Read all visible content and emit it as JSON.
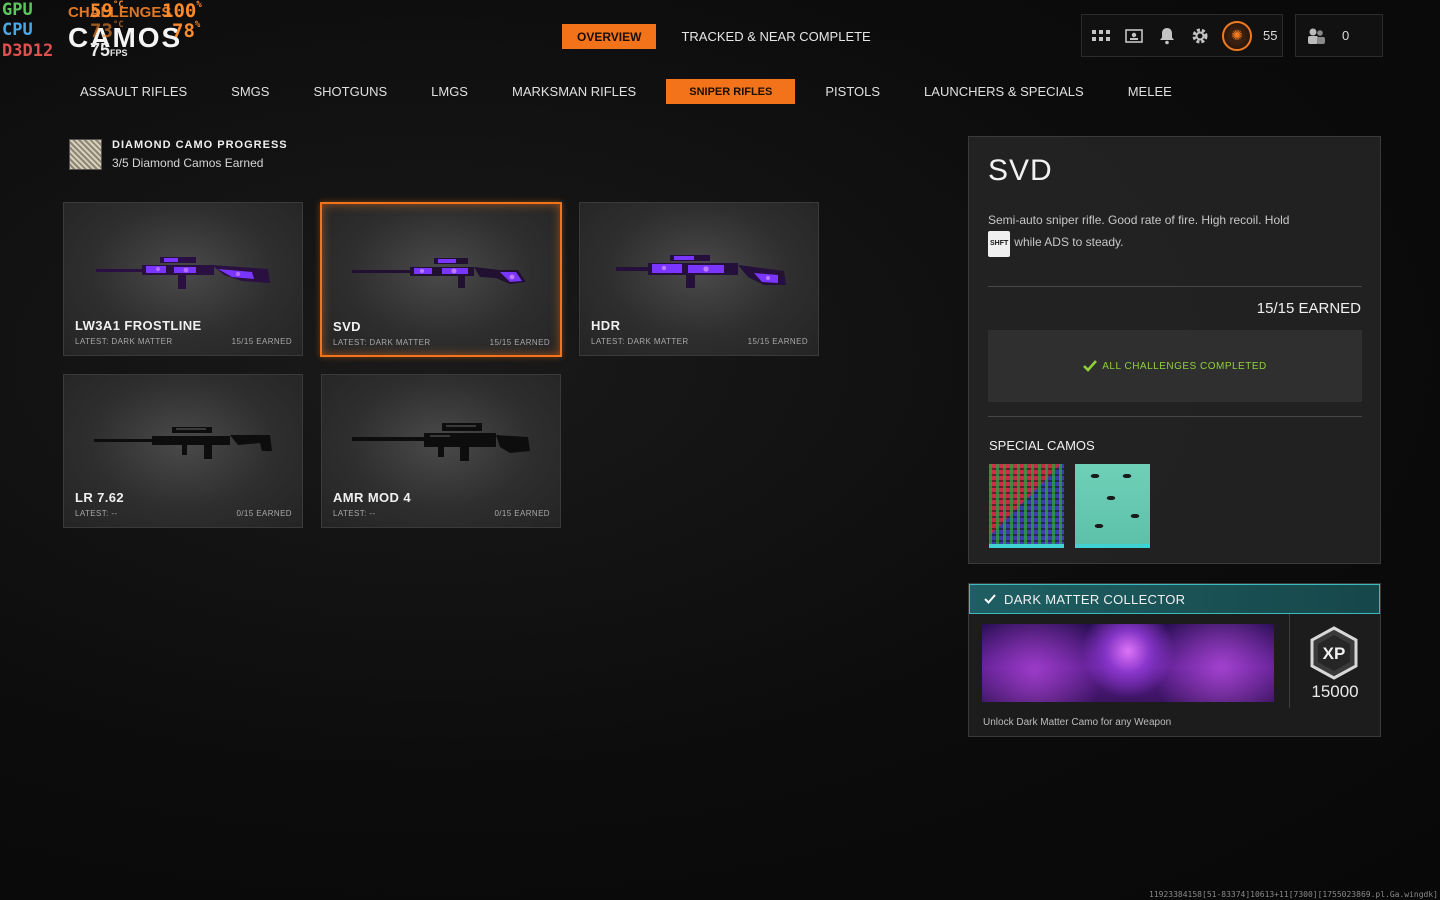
{
  "overlay": {
    "gpu_label": "GPU",
    "cpu_label": "CPU",
    "api_label": "D3D12",
    "gpu_temp": "59",
    "gpu_load": "100",
    "cpu_temp": "73",
    "cpu_load": "78",
    "temp_unit": "°C",
    "load_unit": "%",
    "fps": "75",
    "fps_unit": "FPS"
  },
  "header": {
    "breadcrumb": "CHALLENGES",
    "title": "CAMOS"
  },
  "top_tabs": [
    {
      "label": "OVERVIEW",
      "active": true
    },
    {
      "label": "TRACKED & NEAR COMPLETE",
      "active": false
    }
  ],
  "hud": {
    "icons": [
      "grid-icon",
      "id-card-icon",
      "bell-icon",
      "gear-icon",
      "emblem-icon"
    ],
    "level": "55",
    "party_count": "0"
  },
  "categories": [
    {
      "label": "ASSAULT RIFLES",
      "active": false
    },
    {
      "label": "SMGS",
      "active": false
    },
    {
      "label": "SHOTGUNS",
      "active": false
    },
    {
      "label": "LMGS",
      "active": false
    },
    {
      "label": "MARKSMAN RIFLES",
      "active": false
    },
    {
      "label": "SNIPER RIFLES",
      "active": true
    },
    {
      "label": "PISTOLS",
      "active": false
    },
    {
      "label": "LAUNCHERS & SPECIALS",
      "active": false
    },
    {
      "label": "MELEE",
      "active": false
    }
  ],
  "diamond_progress": {
    "title": "DIAMOND CAMO PROGRESS",
    "subtitle": "3/5 Diamond Camos Earned"
  },
  "weapons": [
    {
      "name": "LW3A1 FROSTLINE",
      "latest": "LATEST: DARK MATTER",
      "earned": "15/15 EARNED",
      "camo": "dark-matter",
      "selected": false
    },
    {
      "name": "SVD",
      "latest": "LATEST: DARK MATTER",
      "earned": "15/15 EARNED",
      "camo": "dark-matter",
      "selected": true
    },
    {
      "name": "HDR",
      "latest": "LATEST: DARK MATTER",
      "earned": "15/15 EARNED",
      "camo": "dark-matter",
      "selected": false
    },
    {
      "name": "LR 7.62",
      "latest": "LATEST: --",
      "earned": "0/15 EARNED",
      "camo": "none",
      "selected": false
    },
    {
      "name": "AMR MOD 4",
      "latest": "LATEST: --",
      "earned": "0/15 EARNED",
      "camo": "none",
      "selected": false
    }
  ],
  "detail": {
    "title": "SVD",
    "desc_part1": "Semi-auto sniper rifle.  Good rate of fire. High recoil.  Hold",
    "key": "SHFT",
    "desc_part2": "while ADS to steady.",
    "earned": "15/15 EARNED",
    "complete_label": "ALL CHALLENGES COMPLETED",
    "special_title": "SPECIAL CAMOS"
  },
  "reward": {
    "title": "DARK MATTER COLLECTOR",
    "xp_label": "XP",
    "xp_amount": "15000",
    "description": "Unlock Dark Matter Camo for any Weapon"
  },
  "build_id": "11923384158[51-83374]10613+11[7300][1755023869.pl.Ga.wingdk]",
  "colors": {
    "accent": "#f2731a",
    "complete_green": "#8fcf3a",
    "reward_teal": "#1e5f63",
    "dark_matter_purple": "#7a35ff"
  }
}
